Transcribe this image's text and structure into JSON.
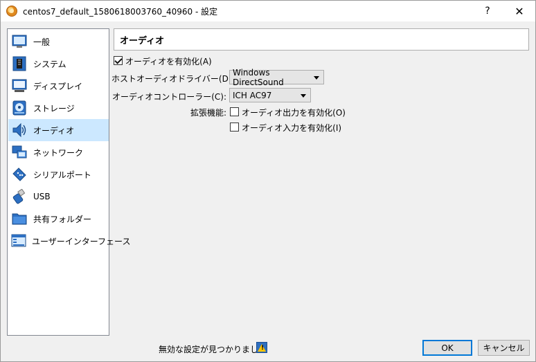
{
  "window": {
    "title": "centos7_default_1580618003760_40960 - 設定",
    "help_glyph": "?",
    "close_glyph": "✕"
  },
  "sidebar": {
    "items": [
      {
        "label": "一般",
        "icon": "general-icon"
      },
      {
        "label": "システム",
        "icon": "system-icon"
      },
      {
        "label": "ディスプレイ",
        "icon": "display-icon"
      },
      {
        "label": "ストレージ",
        "icon": "storage-icon"
      },
      {
        "label": "オーディオ",
        "icon": "audio-icon",
        "selected": true
      },
      {
        "label": "ネットワーク",
        "icon": "network-icon"
      },
      {
        "label": "シリアルポート",
        "icon": "serial-port-icon"
      },
      {
        "label": "USB",
        "icon": "usb-icon"
      },
      {
        "label": "共有フォルダー",
        "icon": "shared-folder-icon"
      },
      {
        "label": "ユーザーインターフェース",
        "icon": "user-interface-icon"
      }
    ]
  },
  "main": {
    "header": "オーディオ",
    "enable_audio": {
      "label": "オーディオを有効化(A)",
      "checked": true
    },
    "host_driver": {
      "label": "ホストオーディオドライバー(D):",
      "value": "Windows DirectSound"
    },
    "controller": {
      "label": "オーディオコントローラー(C):",
      "value": "ICH AC97"
    },
    "extended": {
      "label": "拡張機能:",
      "output": {
        "label": "オーディオ出力を有効化(O)",
        "checked": false
      },
      "input": {
        "label": "オーディオ入力を有効化(I)",
        "checked": false
      }
    }
  },
  "footer": {
    "status": "無効な設定が見つかりました",
    "status_icon": "warning-icon",
    "ok_label": "OK",
    "cancel_label": "キャンセル"
  },
  "colors": {
    "selection": "#cce8ff",
    "default_button_border": "#0078d7"
  }
}
